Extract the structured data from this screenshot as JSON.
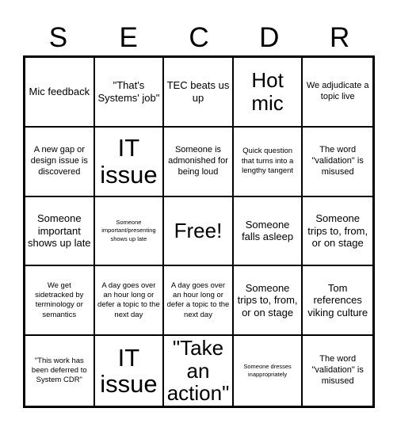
{
  "card": {
    "header_letters": [
      "S",
      "E",
      "C",
      "D",
      "R"
    ],
    "columns": 5,
    "rows": 5,
    "colors": {
      "background": "#ffffff",
      "text": "#000000",
      "border": "#000000"
    },
    "cells": [
      {
        "text": "Mic feedback",
        "size": "md"
      },
      {
        "text": "\"That's Systems' job\"",
        "size": "md"
      },
      {
        "text": "TEC beats us up",
        "size": "md"
      },
      {
        "text": "Hot mic",
        "size": "xl"
      },
      {
        "text": "We adjudicate a topic live",
        "size": "sm"
      },
      {
        "text": "A new gap or design issue is discovered",
        "size": "sm"
      },
      {
        "text": "IT issue",
        "size": "xxl"
      },
      {
        "text": "Someone is admonished for being loud",
        "size": "sm"
      },
      {
        "text": "Quick question that turns into a lengthy tangent",
        "size": "xs"
      },
      {
        "text": "The word \"validation\" is misused",
        "size": "sm"
      },
      {
        "text": "Someone important shows up late",
        "size": "md"
      },
      {
        "text": "Someone important/presenting shows up late",
        "size": "xxs"
      },
      {
        "text": "Free!",
        "size": "xl"
      },
      {
        "text": "Someone falls asleep",
        "size": "md"
      },
      {
        "text": "Someone trips to, from, or on stage",
        "size": "md"
      },
      {
        "text": "We get sidetracked by terminology or semantics",
        "size": "xs"
      },
      {
        "text": "A day goes over an hour long or defer a topic to the next day",
        "size": "xs"
      },
      {
        "text": "A day goes over an hour long or defer a topic to the next day",
        "size": "xs"
      },
      {
        "text": "Someone trips to, from, or on stage",
        "size": "md"
      },
      {
        "text": "Tom references viking culture",
        "size": "md"
      },
      {
        "text": "\"This work has been deferred to System CDR\"",
        "size": "xs"
      },
      {
        "text": "IT issue",
        "size": "xxl"
      },
      {
        "text": "\"Take an action\"",
        "size": "xl"
      },
      {
        "text": "Someone dresses inappropriately",
        "size": "xxs"
      },
      {
        "text": "The word \"validation\" is misused",
        "size": "sm"
      }
    ]
  }
}
